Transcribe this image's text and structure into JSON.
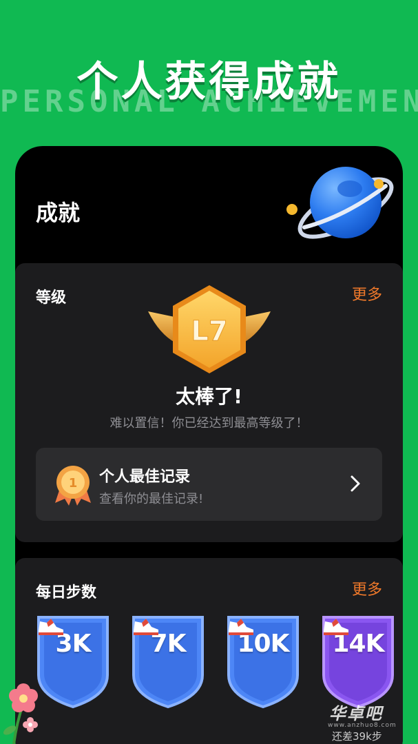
{
  "hero": {
    "title": "个人获得成就",
    "subtitle": "PERSONAL ACHIEVEMENT"
  },
  "page": {
    "title": "成就"
  },
  "level_card": {
    "label": "等级",
    "more": "更多",
    "badge_text": "L7",
    "praise": "太棒了!",
    "praise_sub": "难以置信！你已经达到最高等级了！",
    "record": {
      "medal_number": "1",
      "title": "个人最佳记录",
      "subtitle": "查看你的最佳记录!"
    }
  },
  "steps_card": {
    "label": "每日步数",
    "more": "更多",
    "goals": [
      {
        "label": "3K",
        "color": "#4d86f6"
      },
      {
        "label": "7K",
        "color": "#4d86f6"
      },
      {
        "label": "10K",
        "color": "#4d86f6"
      },
      {
        "label": "14K",
        "color": "#8a56f0"
      }
    ],
    "remaining": "还差39k步"
  },
  "watermark": {
    "text": "华卓吧",
    "url": "www.anzhuo8.com"
  },
  "colors": {
    "background": "#10b952",
    "accent": "#f0792a",
    "card": "#1c1c1e"
  }
}
